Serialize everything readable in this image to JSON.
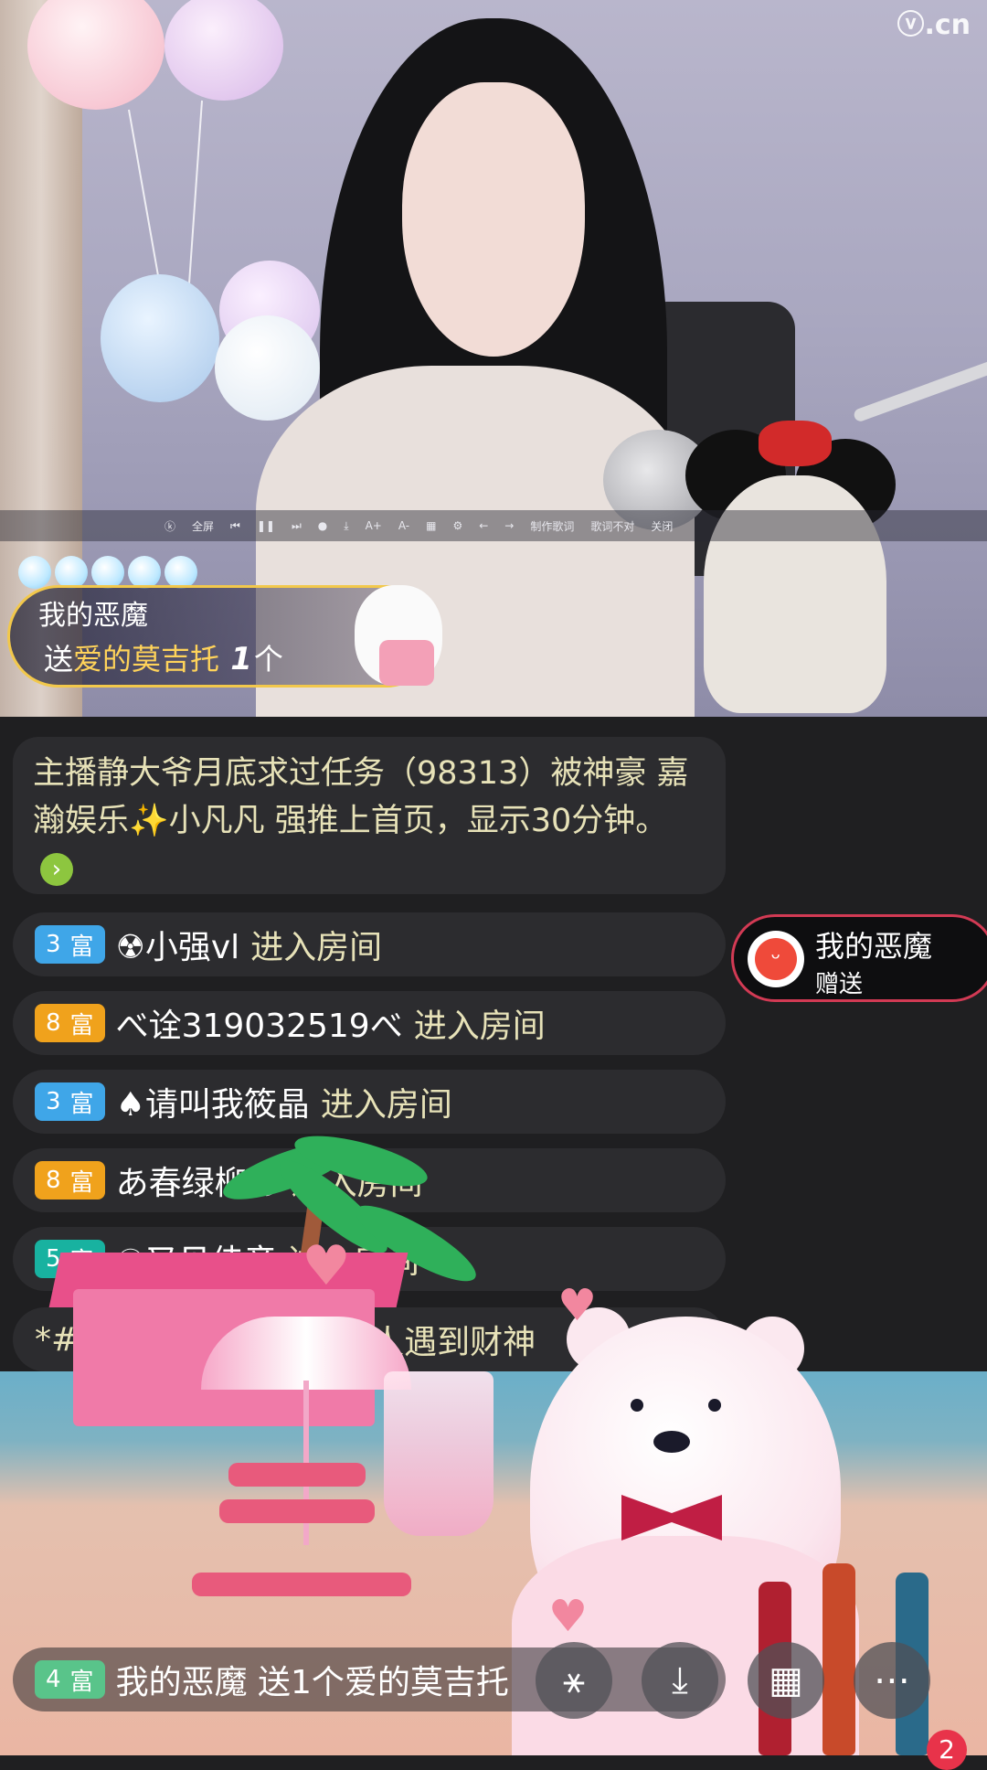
{
  "watermark": "ⓥ.cn",
  "player_toolbar": {
    "items": [
      "ⓚ",
      "全屏",
      "⏮",
      "❚❚",
      "⏭",
      "●",
      "⤓",
      "A+",
      "A-",
      "▦",
      "⚙",
      "←",
      "→",
      "制作歌词",
      "歌词不对",
      "关闭"
    ]
  },
  "gift_banner": {
    "sender": "我的恶魔",
    "prefix": "送",
    "gift_name": "爱的莫吉托",
    "count": "1",
    "unit": "个"
  },
  "announcement": {
    "text_a": " 主播静大爷月底求过任务（98313）被神豪 嘉瀚娱乐",
    "sparkle": "✨",
    "text_b": "小凡凡 强推上首页，显示30分钟。",
    "go_icon": "›"
  },
  "chat": [
    {
      "level": "3",
      "tier": "富",
      "color": "#3fa6e8",
      "user": "☢小强vl",
      "action": "进入房间"
    },
    {
      "level": "8",
      "tier": "富",
      "color": "#f0a21c",
      "user": "べ诠319032519べ",
      "action": "进入房间"
    },
    {
      "level": "3",
      "tier": "富",
      "color": "#3fa6e8",
      "user": "♠请叫我筱晶",
      "action": "进入房间"
    },
    {
      "level": "8",
      "tier": "富",
      "color": "#f0a21c",
      "user": "あ春绿柳あ",
      "action": "进入房间"
    },
    {
      "level": "5",
      "tier": "富",
      "color": "#18b2a0",
      "user": "☯又见佳音",
      "action": "进入房间"
    }
  ],
  "partial_message": "*#",
  "partial_message_tail": "人遇到财神",
  "last_message": {
    "level": "4",
    "tier": "富",
    "color": "#59c48a",
    "text": "我的恶魔 送1个爱的莫吉托"
  },
  "gift_chip": {
    "name": "我的恶魔",
    "sub": "赠送",
    "icon": "face-icon"
  },
  "controls": [
    {
      "name": "share-button",
      "icon": "⚹"
    },
    {
      "name": "download-button",
      "icon": "⤓"
    },
    {
      "name": "grid-menu-button",
      "icon": "▦"
    },
    {
      "name": "more-button",
      "icon": "⋯"
    }
  ],
  "notification_count": "2"
}
